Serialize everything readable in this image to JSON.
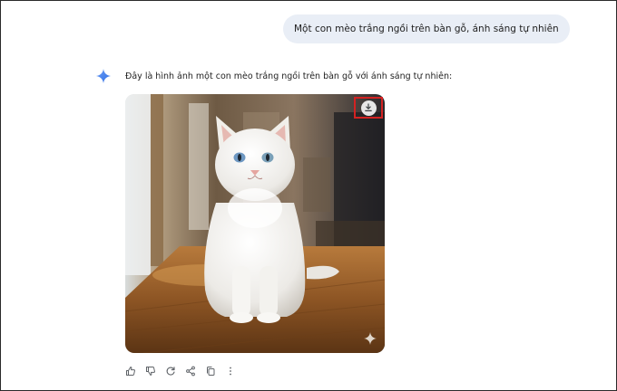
{
  "conversation": {
    "user_prompt": "Một con mèo trắng ngồi trên bàn gỗ, ánh sáng tự nhiên",
    "response_text": "Đây là hình ảnh một con mèo trắng ngồi trên bàn gỗ với ánh sáng tự nhiên:",
    "response_icon": "gemini-spark-icon"
  },
  "image": {
    "subject": "white cat with blue eyes sitting on a wooden table",
    "download_icon": "download-icon",
    "watermark_icon": "sparkle-watermark-icon"
  },
  "actions": [
    {
      "name": "thumb-up-icon"
    },
    {
      "name": "thumb-down-icon"
    },
    {
      "name": "regenerate-icon"
    },
    {
      "name": "share-icon"
    },
    {
      "name": "copy-icon"
    },
    {
      "name": "more-options-icon"
    }
  ],
  "colors": {
    "user_bubble": "#e9eef6",
    "highlight_border": "#d32222",
    "spark_blue": "#4a86f0",
    "icon_gray": "#5f6368"
  }
}
